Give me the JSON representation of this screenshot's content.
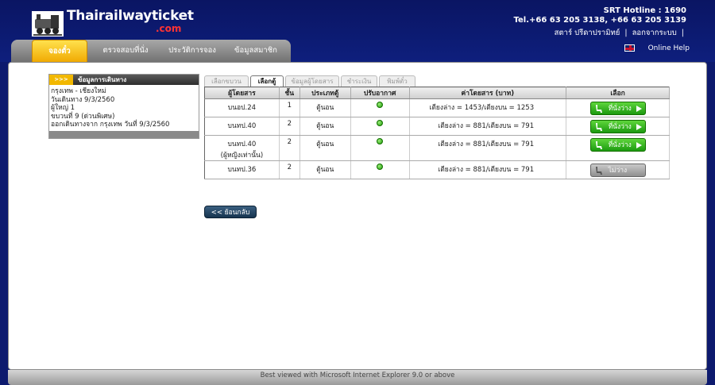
{
  "logo": {
    "name": "Thairailwayticket",
    "suffix": ".com"
  },
  "hotline": {
    "line1": "SRT Hotline : 1690",
    "line2": "Tel.+66 63 205 3138, +66 63 205 3139"
  },
  "user": {
    "name": "สตาร์ ปรีดาปรามิทย์",
    "separator": "|",
    "logout": "ลอกจากระบบ",
    "trailing": "|"
  },
  "nav": {
    "items": [
      {
        "label": "จองตั๋ว",
        "active": true
      },
      {
        "label": "ตรวจสอบที่นั่ง"
      },
      {
        "label": "ประวัติการจอง"
      },
      {
        "label": "ข้อมูลสมาชิก"
      }
    ]
  },
  "help": {
    "label": "Online Help"
  },
  "trip": {
    "arrows": ">>>",
    "title": "ข้อมูลการเดินทาง",
    "lines": [
      "กรุงเทพ - เชียงใหม่",
      "วันเดินทาง 9/3/2560",
      "ผู้ใหญ่ 1",
      "ขบวนที่ 9 (ด่วนพิเศษ)",
      "ออกเดินทางจาก กรุงเทพ วันที่ 9/3/2560"
    ]
  },
  "steps": [
    {
      "label": "เลือกขบวน"
    },
    {
      "label": "เลือกตู้",
      "active": true
    },
    {
      "label": "ข้อมูลผู้โดยสาร"
    },
    {
      "label": "ชำระเงิน"
    },
    {
      "label": "พิมพ์ตั๋ว"
    }
  ],
  "table": {
    "headers": [
      "ผู้โดยสาร",
      "ชั้น",
      "ประเภทตู้",
      "ปรับอากาศ",
      "ค่าโดยสาร (บาท)",
      "เลือก"
    ],
    "rows": [
      {
        "car": "บนอป.24",
        "car2": "",
        "class": "1",
        "type": "ตู้นอน",
        "ac": true,
        "fare": "เตียงล่าง = 1453/เตียงบน = 1253",
        "button": "ที่นั่งว่าง",
        "available": true
      },
      {
        "car": "บนทป.40",
        "car2": "",
        "class": "2",
        "type": "ตู้นอน",
        "ac": true,
        "fare": "เตียงล่าง = 881/เตียงบน = 791",
        "button": "ที่นั่งว่าง",
        "available": true
      },
      {
        "car": "บนทป.40",
        "car2": "(ผู้หญิงเท่านั้น)",
        "class": "2",
        "type": "ตู้นอน",
        "ac": true,
        "fare": "เตียงล่าง = 881/เตียงบน = 791",
        "button": "ที่นั่งว่าง",
        "available": true
      },
      {
        "car": "บนทป.36",
        "car2": "",
        "class": "2",
        "type": "ตู้นอน",
        "ac": true,
        "fare": "เตียงล่าง = 881/เตียงบน = 791",
        "button": "ไม่ว่าง",
        "available": false
      }
    ]
  },
  "back": {
    "label": "<< ย้อนกลับ"
  },
  "footer": {
    "text": "Best viewed with Microsoft Internet Explorer 9.0 or above"
  },
  "colors": {
    "header_bg": "#0d1a6e",
    "active_tab": "#f0a800",
    "available": "#1c9a10",
    "unavailable": "#8f8f8f"
  }
}
